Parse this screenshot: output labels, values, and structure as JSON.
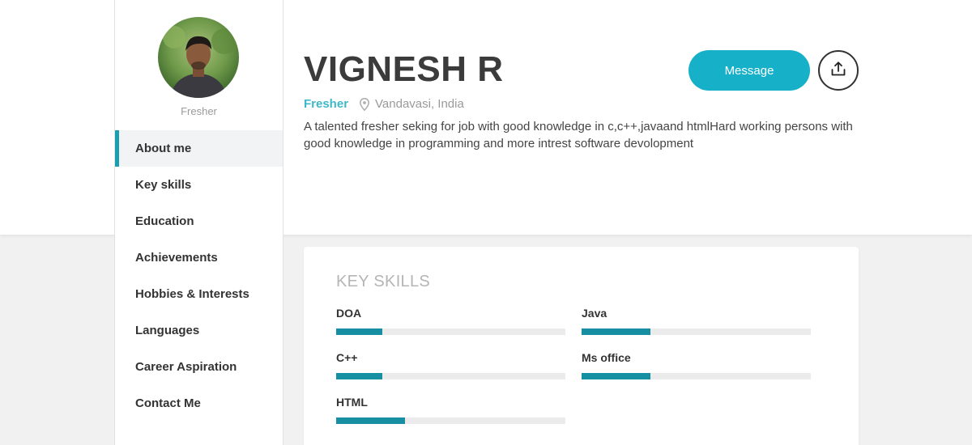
{
  "profile": {
    "avatar_caption": "Fresher",
    "name": "VIGNESH R",
    "role": "Fresher",
    "location": "Vandavasi, India",
    "bio": "A talented fresher seking for job with good knowledge in c,c++,javaand htmlHard working persons with good knowledge in programming and more intrest software devolopment"
  },
  "actions": {
    "message_label": "Message",
    "share_icon": "share-upload-icon"
  },
  "sidebar": {
    "active_index": 0,
    "items": [
      {
        "label": "About me"
      },
      {
        "label": "Key skills"
      },
      {
        "label": "Education"
      },
      {
        "label": "Achievements"
      },
      {
        "label": "Hobbies & Interests"
      },
      {
        "label": "Languages"
      },
      {
        "label": "Career Aspiration"
      },
      {
        "label": "Contact Me"
      }
    ]
  },
  "key_skills": {
    "title": "KEY SKILLS",
    "skills": [
      {
        "name": "DOA",
        "level": 0.2
      },
      {
        "name": "Java",
        "level": 0.3
      },
      {
        "name": "C++",
        "level": 0.2
      },
      {
        "name": "Ms office",
        "level": 0.3
      },
      {
        "name": "HTML",
        "level": 0.3
      }
    ]
  },
  "colors": {
    "accent": "#16b1c9",
    "accent_dark": "#168fa2",
    "role_text": "#3db8c9"
  }
}
